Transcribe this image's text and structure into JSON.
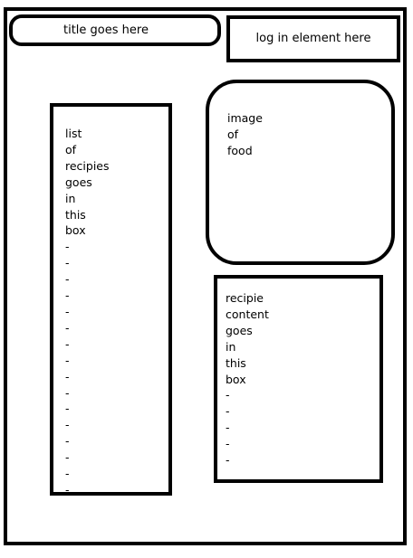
{
  "title_box": {
    "text": "title goes here"
  },
  "login_box": {
    "text": "log in element here"
  },
  "recipe_list_box": {
    "lines": [
      "list",
      "of",
      "recipies",
      "goes",
      "in",
      "this",
      "box",
      "-",
      "-",
      "-",
      "-",
      "-",
      "-",
      "-",
      "-",
      "-",
      "-",
      "-",
      "-",
      "-",
      "-",
      "-",
      "-"
    ]
  },
  "food_image_box": {
    "lines": [
      "image",
      "of",
      "food"
    ]
  },
  "recipe_content_box": {
    "lines": [
      "recipie",
      "content",
      "goes",
      "in",
      "this",
      "box",
      "-",
      "-",
      "-",
      "-",
      "-"
    ]
  }
}
